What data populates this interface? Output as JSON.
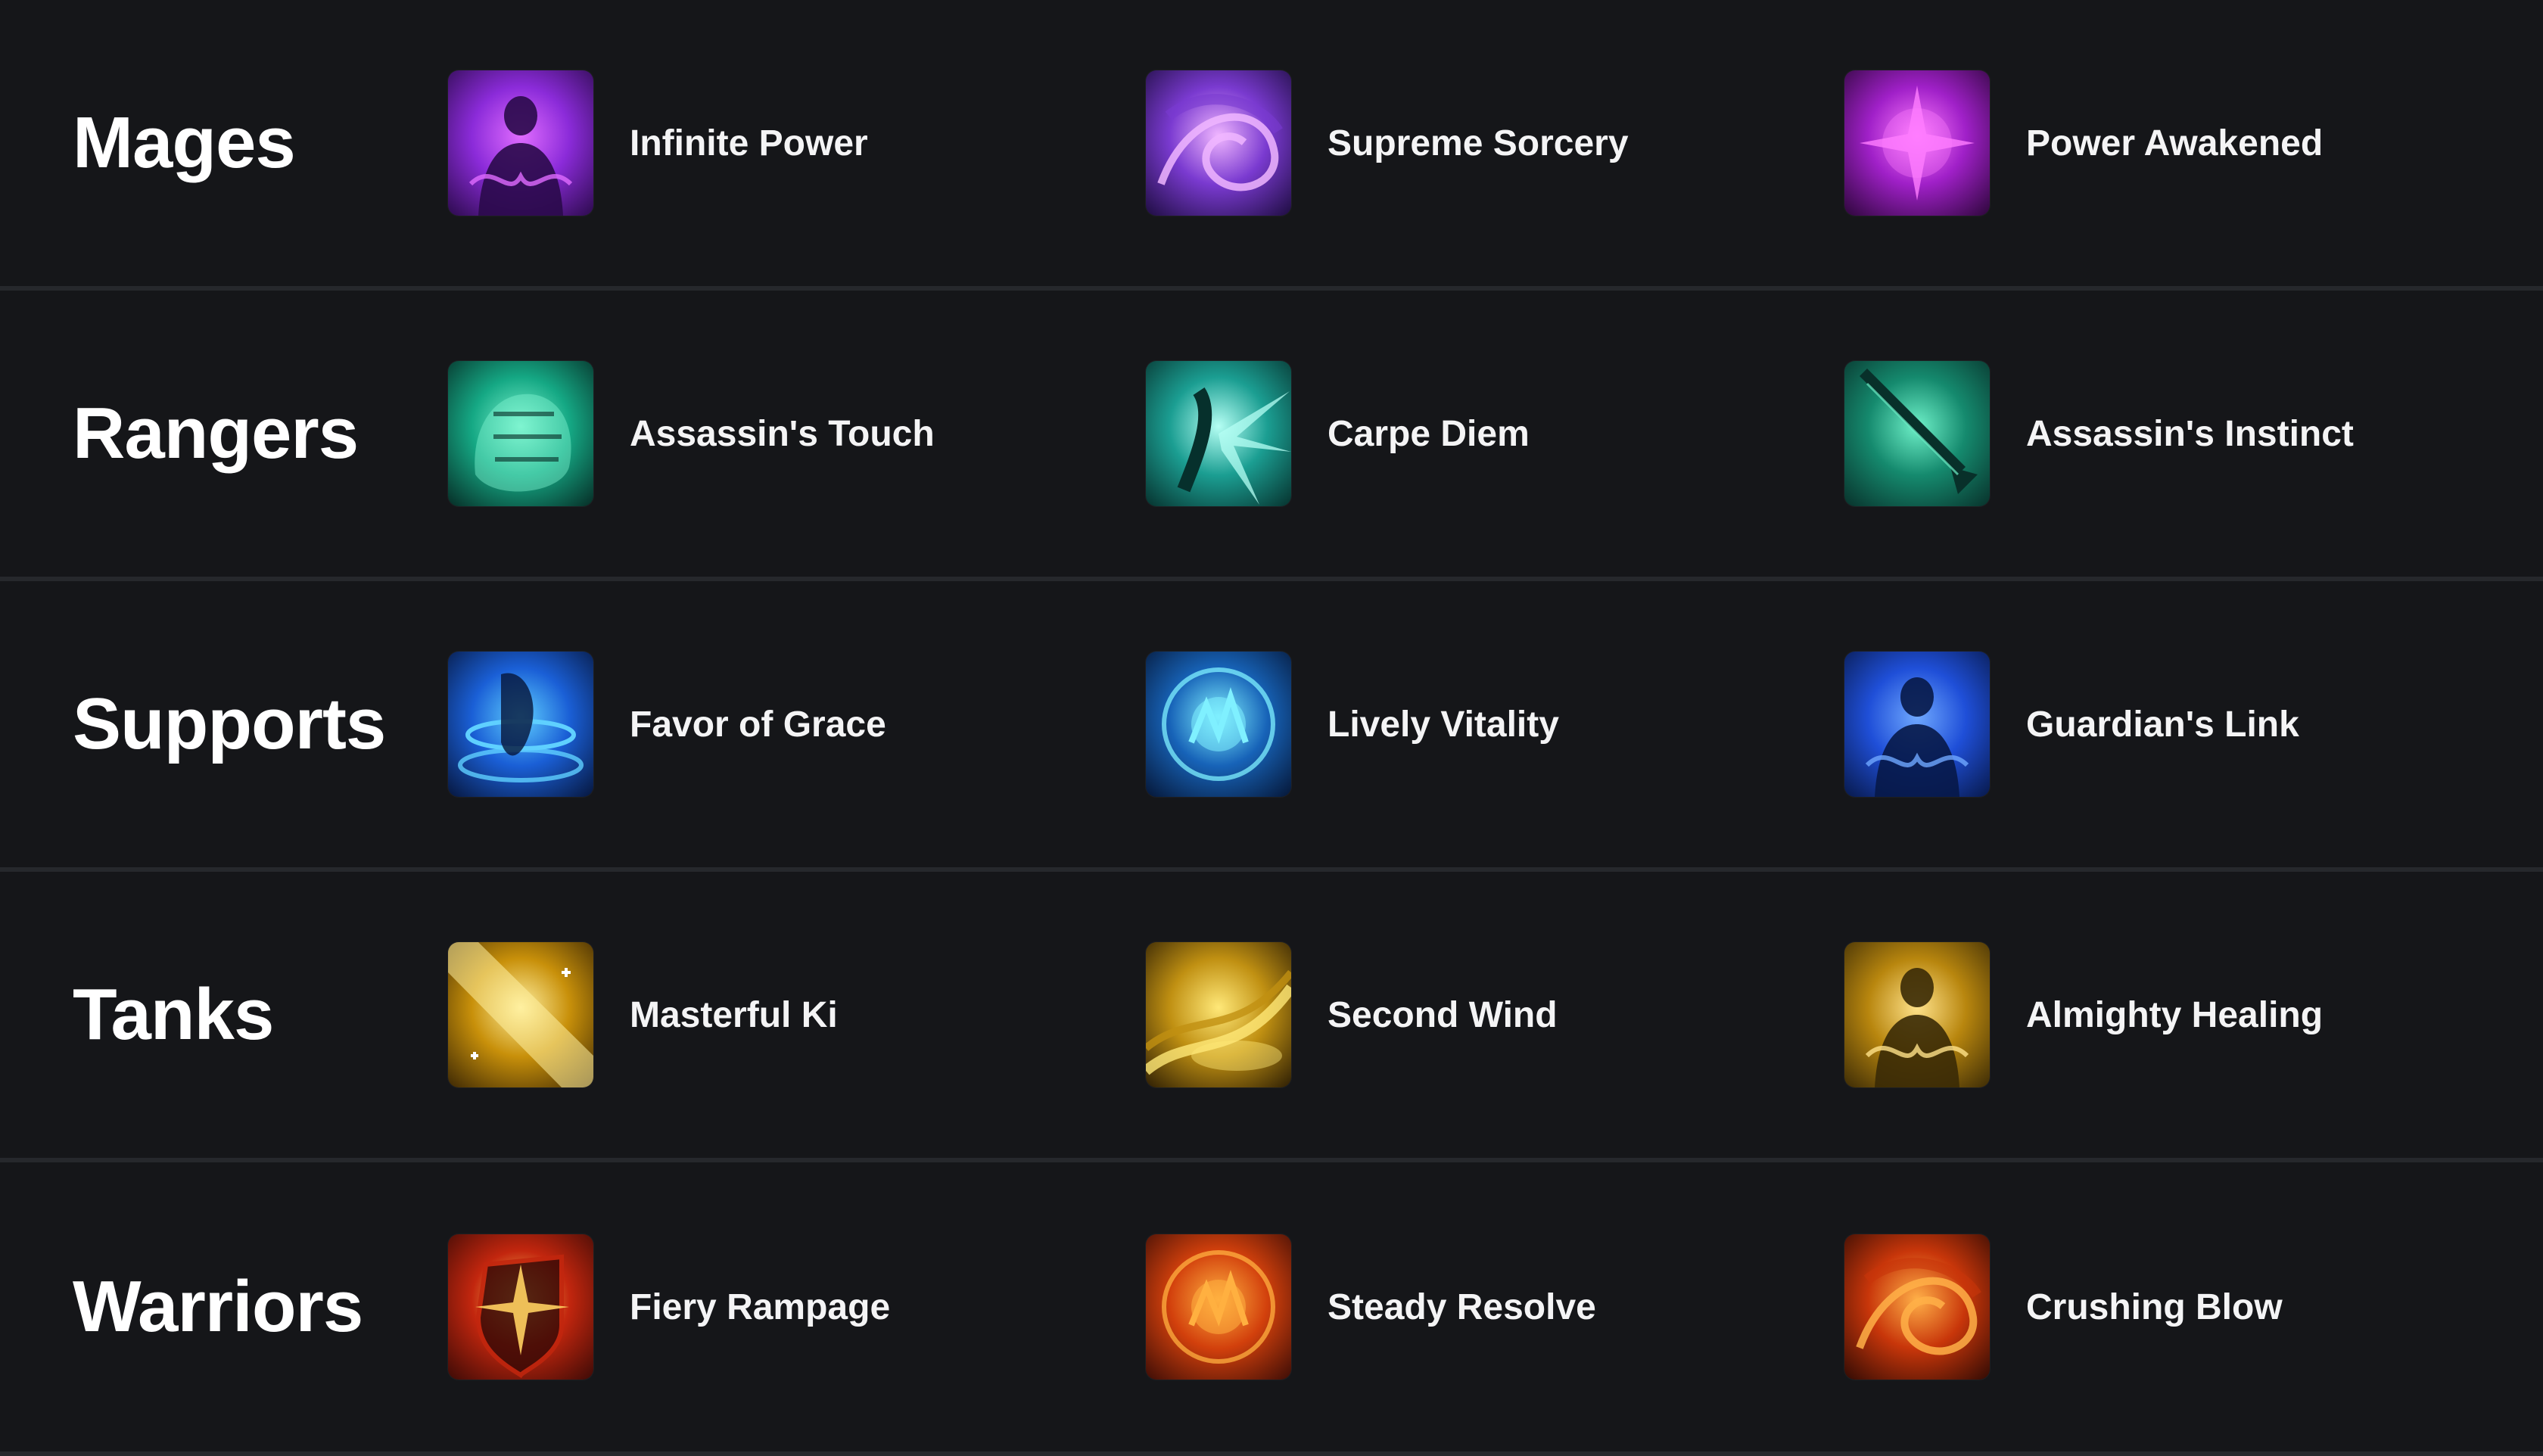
{
  "rows": [
    {
      "class_name": "Mages",
      "perks": [
        {
          "label": "Infinite Power",
          "icon": "infinite-power-icon",
          "colors": [
            "#2a0a4a",
            "#8b2bd9",
            "#e06cff"
          ]
        },
        {
          "label": "Supreme Sorcery",
          "icon": "supreme-sorcery-icon",
          "colors": [
            "#1c0c3e",
            "#7a3ad0",
            "#f0b6ff"
          ]
        },
        {
          "label": "Power Awakened",
          "icon": "power-awakened-icon",
          "colors": [
            "#2b0638",
            "#a020c8",
            "#ff7dff"
          ]
        }
      ]
    },
    {
      "class_name": "Rangers",
      "perks": [
        {
          "label": "Assassin's Touch",
          "icon": "assassins-touch-icon",
          "colors": [
            "#062a24",
            "#15a884",
            "#7ff5d0"
          ]
        },
        {
          "label": "Carpe Diem",
          "icon": "carpe-diem-icon",
          "colors": [
            "#06302c",
            "#1b9e92",
            "#b5fff4"
          ]
        },
        {
          "label": "Assassin's Instinct",
          "icon": "assassins-instinct-icon",
          "colors": [
            "#08302a",
            "#158a6e",
            "#6ef0c8"
          ]
        }
      ]
    },
    {
      "class_name": "Supports",
      "perks": [
        {
          "label": "Favor of Grace",
          "icon": "favor-of-grace-icon",
          "colors": [
            "#06153a",
            "#1a5fd6",
            "#5fd0ff"
          ]
        },
        {
          "label": "Lively Vitality",
          "icon": "lively-vitality-icon",
          "colors": [
            "#051534",
            "#1763b8",
            "#7ff0ff"
          ]
        },
        {
          "label": "Guardian's Link",
          "icon": "guardians-link-icon",
          "colors": [
            "#071848",
            "#1f4fd8",
            "#6fa8ff"
          ]
        }
      ]
    },
    {
      "class_name": "Tanks",
      "perks": [
        {
          "label": "Masterful Ki",
          "icon": "masterful-ki-icon",
          "colors": [
            "#3a2604",
            "#c8900a",
            "#fff0a0"
          ]
        },
        {
          "label": "Second Wind",
          "icon": "second-wind-icon",
          "colors": [
            "#2a1c04",
            "#c09012",
            "#ffe878"
          ]
        },
        {
          "label": "Almighty Healing",
          "icon": "almighty-healing-icon",
          "colors": [
            "#3a2a06",
            "#b8860e",
            "#ffe28a"
          ]
        }
      ]
    },
    {
      "class_name": "Warriors",
      "perks": [
        {
          "label": "Fiery Rampage",
          "icon": "fiery-rampage-icon",
          "colors": [
            "#3a0a06",
            "#c2260e",
            "#ffd060"
          ]
        },
        {
          "label": "Steady Resolve",
          "icon": "steady-resolve-icon",
          "colors": [
            "#3a0c06",
            "#d2400c",
            "#ffb040"
          ]
        },
        {
          "label": "Crushing Blow",
          "icon": "crushing-blow-icon",
          "colors": [
            "#2e0a04",
            "#c8360a",
            "#ffb048"
          ]
        }
      ]
    }
  ]
}
